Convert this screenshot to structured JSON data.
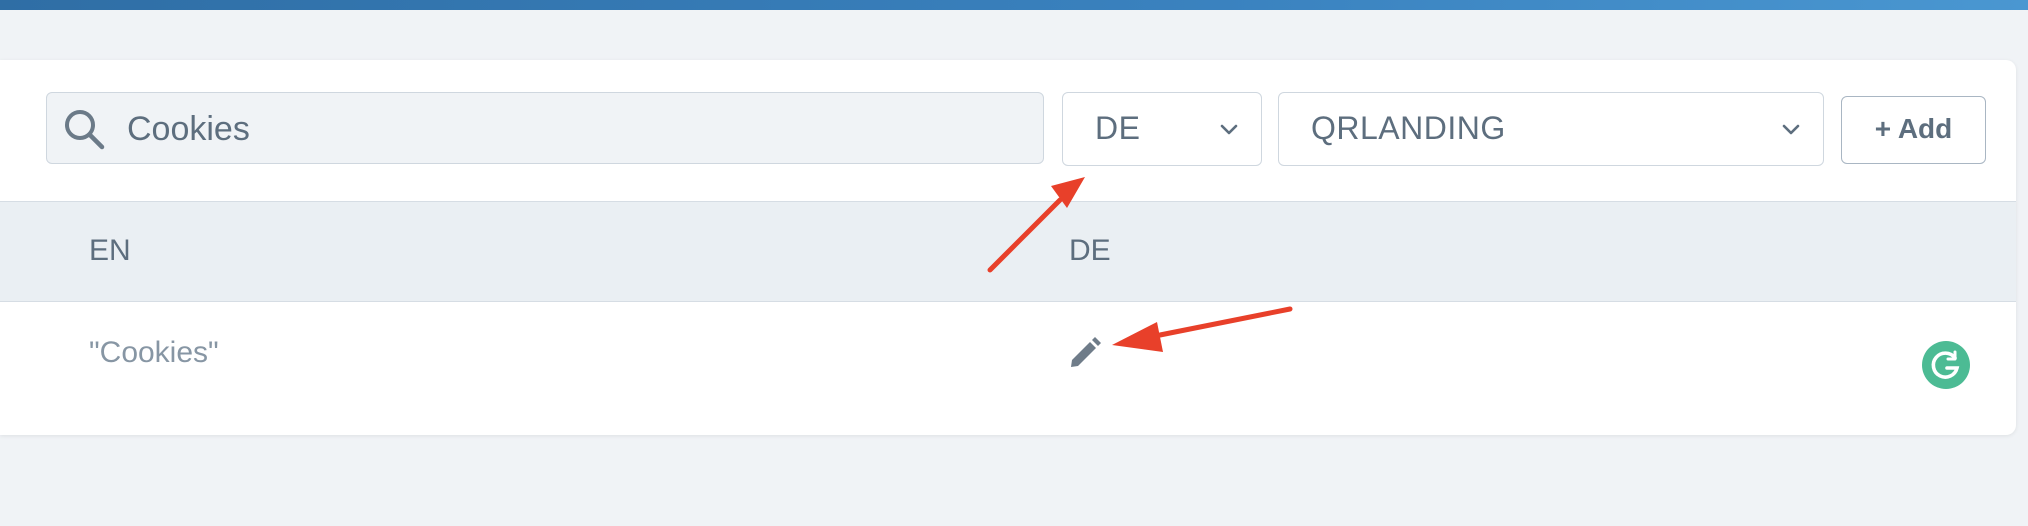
{
  "search": {
    "value": "Cookies",
    "icon": "search-icon"
  },
  "filters": {
    "language": {
      "selected": "DE"
    },
    "project": {
      "selected": "QRLANDING"
    }
  },
  "toolbar": {
    "add_label": "+ Add"
  },
  "table": {
    "headers": [
      "EN",
      "DE"
    ],
    "rows": [
      {
        "en": "\"Cookies\"",
        "de_action_icon": "pencil-icon"
      }
    ]
  },
  "colors": {
    "topbar": "#3a82bf",
    "annotation_arrow": "#e8402a",
    "grammarly_badge": "#4cbb94"
  }
}
